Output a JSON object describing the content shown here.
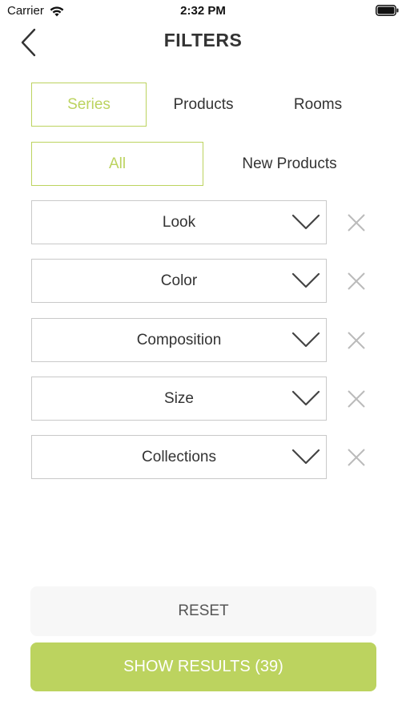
{
  "status_bar": {
    "carrier": "Carrier",
    "time": "2:32 PM"
  },
  "nav": {
    "title": "FILTERS",
    "back_icon": "chevron-left-icon"
  },
  "tabs": [
    {
      "label": "Series",
      "active": true
    },
    {
      "label": "Products",
      "active": false
    },
    {
      "label": "Rooms",
      "active": false
    }
  ],
  "subtabs": [
    {
      "label": "All",
      "active": true
    },
    {
      "label": "New Products",
      "active": false
    }
  ],
  "filters": [
    {
      "label": "Look"
    },
    {
      "label": "Color"
    },
    {
      "label": "Composition"
    },
    {
      "label": "Size"
    },
    {
      "label": "Collections"
    }
  ],
  "actions": {
    "reset_label": "RESET",
    "show_results_label": "SHOW RESULTS (39)"
  },
  "colors": {
    "accent": "#bcd35f",
    "border": "#c9c9c9",
    "reset_bg": "#f7f7f7"
  }
}
